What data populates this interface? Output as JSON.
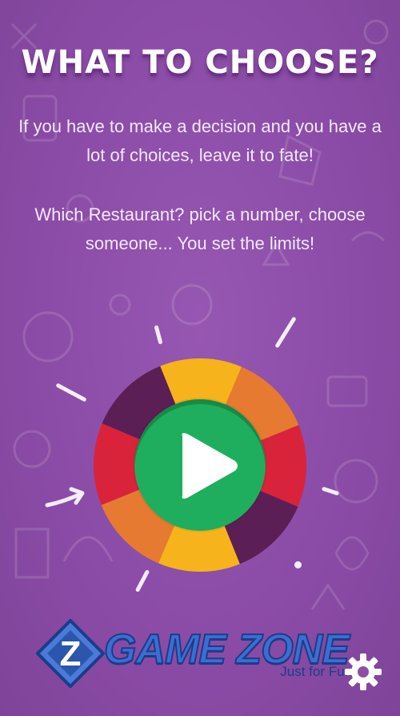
{
  "screen": {
    "title": "WHAT TO CHOOSE?",
    "description_1": "If you have to make a decision and you have a lot of choices, leave it to fate!",
    "description_2": "Which Restaurant? pick a number, choose someone... You set the limits!"
  },
  "wheel": {
    "segment_colors": [
      "#f6b31b",
      "#e77a31",
      "#d9233a",
      "#5b1f55",
      "#f6b31b",
      "#e77a31",
      "#d9233a",
      "#5b1f55"
    ],
    "play_color": "#1fae5d",
    "icon": "play-icon"
  },
  "logo": {
    "name": "GAME ZONE",
    "tagline": "Just for Fun",
    "emblem_letter": "Z"
  },
  "settings": {
    "icon": "gear-icon"
  },
  "colors": {
    "background": "#8b4fa6",
    "text": "#ffffff"
  }
}
